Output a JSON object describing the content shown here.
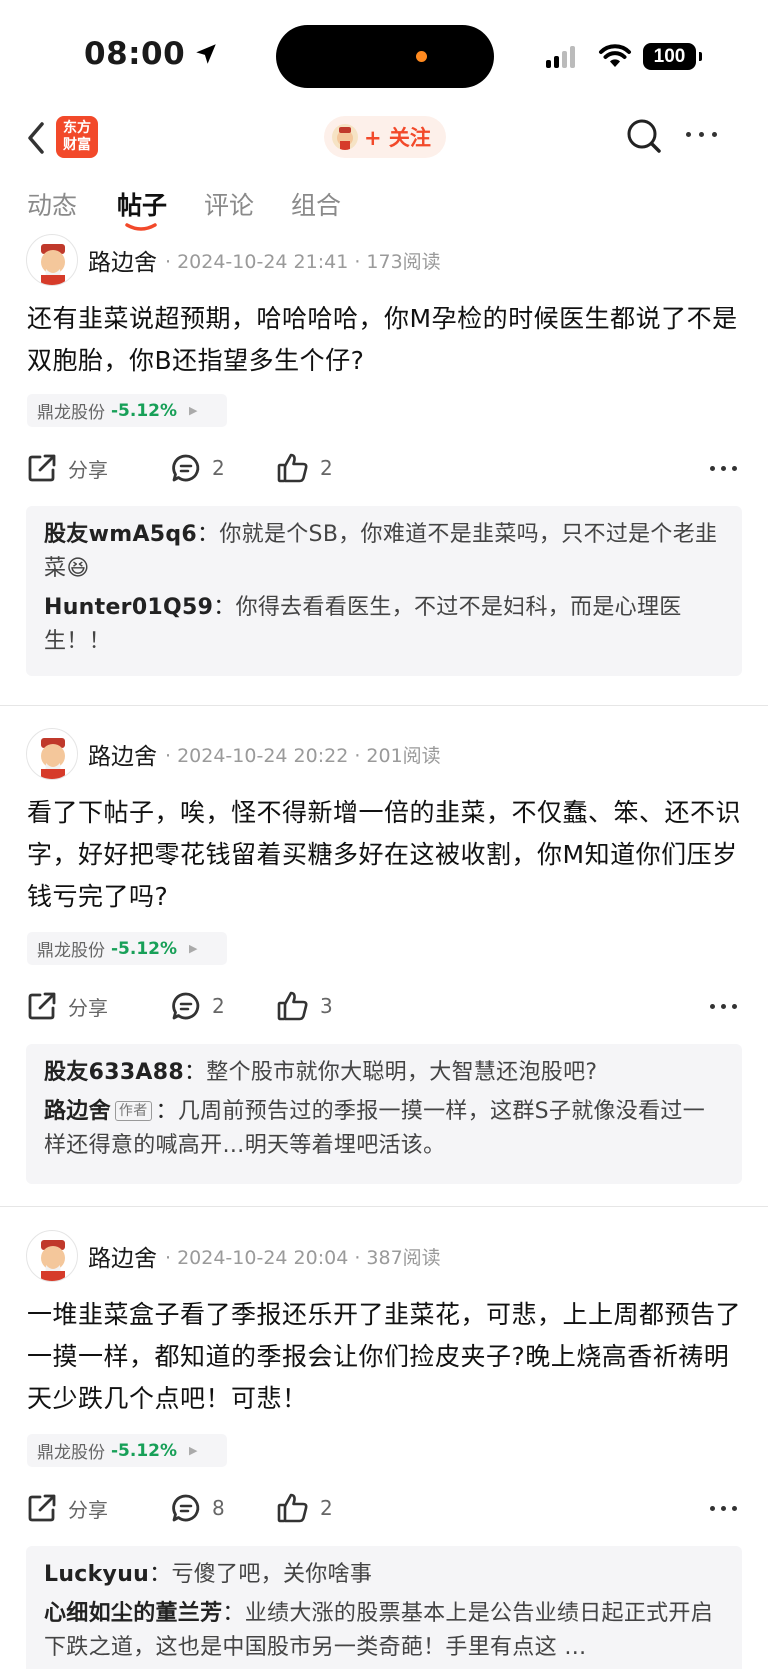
{
  "status_bar": {
    "time": "08:00",
    "battery": "100"
  },
  "nav": {
    "logo_line1": "东方",
    "logo_line2": "财富",
    "follow_label": "+ 关注"
  },
  "tabs": [
    {
      "label": "动态"
    },
    {
      "label": "帖子"
    },
    {
      "label": "评论"
    },
    {
      "label": "组合"
    }
  ],
  "posts": [
    {
      "author": "路边舍",
      "meta": "· 2024-10-24 21:41 · 173阅读",
      "body": "还有韭菜说超预期，哈哈哈哈，你M孕检的时候医生都说了不是双胞胎，你B还指望多生个仔?",
      "stock_name": "鼎龙股份",
      "stock_change": "-5.12%",
      "share_label": "分享",
      "comment_count": "2",
      "like_count": "2",
      "comments": [
        {
          "user": "股友wmA5q6",
          "sep": "：",
          "text": "你就是个SB，你难道不是韭菜吗，只不过是个老韭菜",
          "emoji": "😆"
        },
        {
          "user": "Hunter01Q59",
          "sep": "：",
          "text": "你得去看看医生，不过不是妇科，而是心理医生！！"
        }
      ]
    },
    {
      "author": "路边舍",
      "meta": "· 2024-10-24 20:22 · 201阅读",
      "body": "看了下帖子，唉，怪不得新增一倍的韭菜，不仅蠢、笨、还不识字，好好把零花钱留着买糖多好在这被收割，你M知道你们压岁钱亏完了吗?",
      "stock_name": "鼎龙股份",
      "stock_change": "-5.12%",
      "share_label": "分享",
      "comment_count": "2",
      "like_count": "3",
      "comments": [
        {
          "user": "股友633A88",
          "sep": "：",
          "text": "整个股市就你大聪明，大智慧还泡股吧?"
        },
        {
          "user": "路边舍",
          "badge": "作者",
          "sep": "：",
          "text": "几周前预告过的季报一摸一样，这群S子就像没看过一样还得意的喊高开…明天等着埋吧活该。"
        }
      ]
    },
    {
      "author": "路边舍",
      "meta": "· 2024-10-24 20:04 · 387阅读",
      "body": "一堆韭菜盒子看了季报还乐开了韭菜花，可悲，上上周都预告了一摸一样，都知道的季报会让你们捡皮夹子?晚上烧高香祈祷明天少跌几个点吧！可悲！",
      "stock_name": "鼎龙股份",
      "stock_change": "-5.12%",
      "share_label": "分享",
      "comment_count": "8",
      "like_count": "2",
      "comments": [
        {
          "user": "Luckyuu",
          "sep": "：",
          "text": "亏傻了吧，关你啥事"
        },
        {
          "user": "心细如尘的董兰芳",
          "sep": "：",
          "text": "业绩大涨的股票基本上是公告业绩日起正式开启下跌之道，这也是中国股市另一类奇葩！手里有点这 …"
        }
      ]
    }
  ]
}
